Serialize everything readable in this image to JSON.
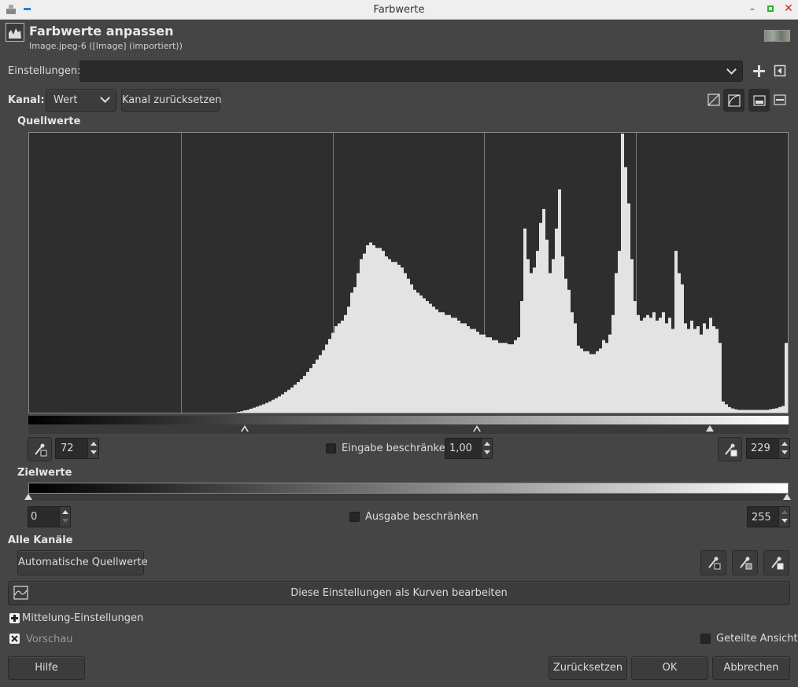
{
  "window": {
    "title": "Farbwerte"
  },
  "header": {
    "title": "Farbwerte anpassen",
    "subtitle": "Image.jpeg-6 ([Image] (importiert))"
  },
  "presets": {
    "label": "Einstellungen:",
    "value": ""
  },
  "channel": {
    "label": "Kanal:",
    "value": "Wert",
    "reset_label": "Kanal zurücksetzen"
  },
  "input": {
    "section_label": "Quellwerte",
    "low": "72",
    "gamma": "1,00",
    "high": "229",
    "clamp_label": "Eingabe beschränken",
    "clamp_checked": false
  },
  "output": {
    "section_label": "Zielwerte",
    "low": "0",
    "high": "255",
    "clamp_label": "Ausgabe beschränken",
    "clamp_checked": false
  },
  "all_channels": {
    "section_label": "Alle Kanäle",
    "auto_label": "Automatische Quellwerte"
  },
  "curves_button": "Diese Einstellungen als Kurven bearbeiten",
  "blend_options": "Mittelung-Einstellungen",
  "preview": {
    "label": "Vorschau",
    "checked": true
  },
  "split_view": {
    "label": "Geteilte Ansicht",
    "checked": false
  },
  "buttons": {
    "help": "Hilfe",
    "reset": "Zurücksetzen",
    "ok": "OK",
    "cancel": "Abbrechen"
  },
  "histogram": {
    "bins": [
      0,
      0,
      0,
      0,
      0,
      0,
      0,
      0,
      0,
      0,
      0,
      0,
      0,
      0,
      0,
      0,
      0,
      0,
      0,
      0,
      0,
      0,
      0,
      0,
      0,
      0,
      0,
      0,
      0,
      0,
      0,
      0,
      0,
      0,
      0,
      0,
      0,
      0,
      0,
      0,
      0,
      0,
      0,
      0,
      0,
      0,
      0,
      0,
      0,
      0,
      0,
      0,
      0,
      0,
      0,
      0,
      0,
      0,
      0,
      0,
      0,
      0,
      0,
      0,
      0,
      0,
      0.003,
      0.005,
      0.008,
      0.01,
      0.014,
      0.018,
      0.022,
      0.026,
      0.03,
      0.035,
      0.04,
      0.046,
      0.052,
      0.058,
      0.066,
      0.074,
      0.082,
      0.09,
      0.1,
      0.11,
      0.12,
      0.132,
      0.146,
      0.16,
      0.175,
      0.19,
      0.206,
      0.224,
      0.244,
      0.264,
      0.286,
      0.31,
      0.32,
      0.33,
      0.35,
      0.38,
      0.43,
      0.45,
      0.5,
      0.55,
      0.57,
      0.6,
      0.61,
      0.6,
      0.59,
      0.59,
      0.58,
      0.56,
      0.55,
      0.54,
      0.54,
      0.53,
      0.52,
      0.5,
      0.48,
      0.46,
      0.44,
      0.43,
      0.42,
      0.41,
      0.4,
      0.39,
      0.38,
      0.37,
      0.36,
      0.36,
      0.35,
      0.35,
      0.34,
      0.34,
      0.33,
      0.32,
      0.32,
      0.31,
      0.3,
      0.3,
      0.29,
      0.28,
      0.28,
      0.27,
      0.27,
      0.26,
      0.26,
      0.25,
      0.25,
      0.25,
      0.245,
      0.245,
      0.26,
      0.27,
      0.4,
      0.66,
      0.55,
      0.5,
      0.52,
      0.58,
      0.68,
      0.73,
      0.62,
      0.5,
      0.55,
      0.66,
      0.8,
      0.56,
      0.48,
      0.44,
      0.36,
      0.32,
      0.24,
      0.23,
      0.22,
      0.22,
      0.21,
      0.21,
      0.22,
      0.23,
      0.26,
      0.25,
      0.28,
      0.35,
      0.5,
      0.58,
      1.0,
      0.88,
      0.75,
      0.55,
      0.4,
      0.35,
      0.33,
      0.34,
      0.35,
      0.34,
      0.36,
      0.33,
      0.34,
      0.36,
      0.32,
      0.34,
      0.3,
      0.58,
      0.5,
      0.46,
      0.32,
      0.3,
      0.33,
      0.3,
      0.31,
      0.28,
      0.32,
      0.3,
      0.34,
      0.31,
      0.3,
      0.25,
      0.04,
      0.03,
      0.02,
      0.015,
      0.012,
      0.01,
      0.01,
      0.01,
      0.01,
      0.01,
      0.01,
      0.01,
      0.01,
      0.01,
      0.01,
      0.012,
      0.014,
      0.016,
      0.02,
      0.024,
      0.25
    ]
  },
  "icons": [
    "gimp-app-icon",
    "minimize-icon",
    "close-icon",
    "histogram-icon",
    "add-icon",
    "menu-icon",
    "linear-scale-icon",
    "log-scale-icon",
    "chevron-down-icon",
    "pick-black-icon",
    "pick-gray-icon",
    "pick-white-icon",
    "curves-icon",
    "expand-icon",
    "checkbox-icon"
  ]
}
